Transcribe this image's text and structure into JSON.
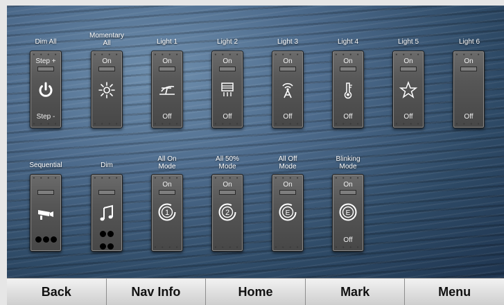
{
  "switches_row1": [
    {
      "label": "Dim All",
      "top": "Step +",
      "bottom": "Step -",
      "icon": "power-icon"
    },
    {
      "label": "Momentary\nAll",
      "top": "On",
      "bottom": "",
      "icon": "sun-icon"
    },
    {
      "label": "Light 1",
      "top": "On",
      "bottom": "Off",
      "icon": "flow-meter-icon"
    },
    {
      "label": "Light 2",
      "top": "On",
      "bottom": "Off",
      "icon": "heater-icon"
    },
    {
      "label": "Light 3",
      "top": "On",
      "bottom": "Off",
      "icon": "antenna-icon"
    },
    {
      "label": "Light 4",
      "top": "On",
      "bottom": "Off",
      "icon": "thermometer-icon"
    },
    {
      "label": "Light 5",
      "top": "On",
      "bottom": "Off",
      "icon": "star-icon"
    },
    {
      "label": "Light 6",
      "top": "On",
      "bottom": "Off",
      "icon": ""
    }
  ],
  "switches_row2": [
    {
      "label": "Sequential",
      "top": "",
      "bottom": "",
      "icon": "camera-icon",
      "dots": 3
    },
    {
      "label": "Dim",
      "top": "",
      "bottom": "",
      "icon": "music-note-icon",
      "dots": 4
    },
    {
      "label": "All On\nMode",
      "top": "On",
      "bottom": "",
      "icon": "mode-1-icon"
    },
    {
      "label": "All 50%\nMode",
      "top": "On",
      "bottom": "",
      "icon": "mode-2-icon"
    },
    {
      "label": "All Off\nMode",
      "top": "On",
      "bottom": "",
      "icon": "mode-e-icon"
    },
    {
      "label": "Blinking\nMode",
      "top": "On",
      "bottom": "Off",
      "icon": "mode-e-icon"
    }
  ],
  "nav": {
    "back": "Back",
    "nav_info": "Nav Info",
    "home": "Home",
    "mark": "Mark",
    "menu": "Menu"
  }
}
